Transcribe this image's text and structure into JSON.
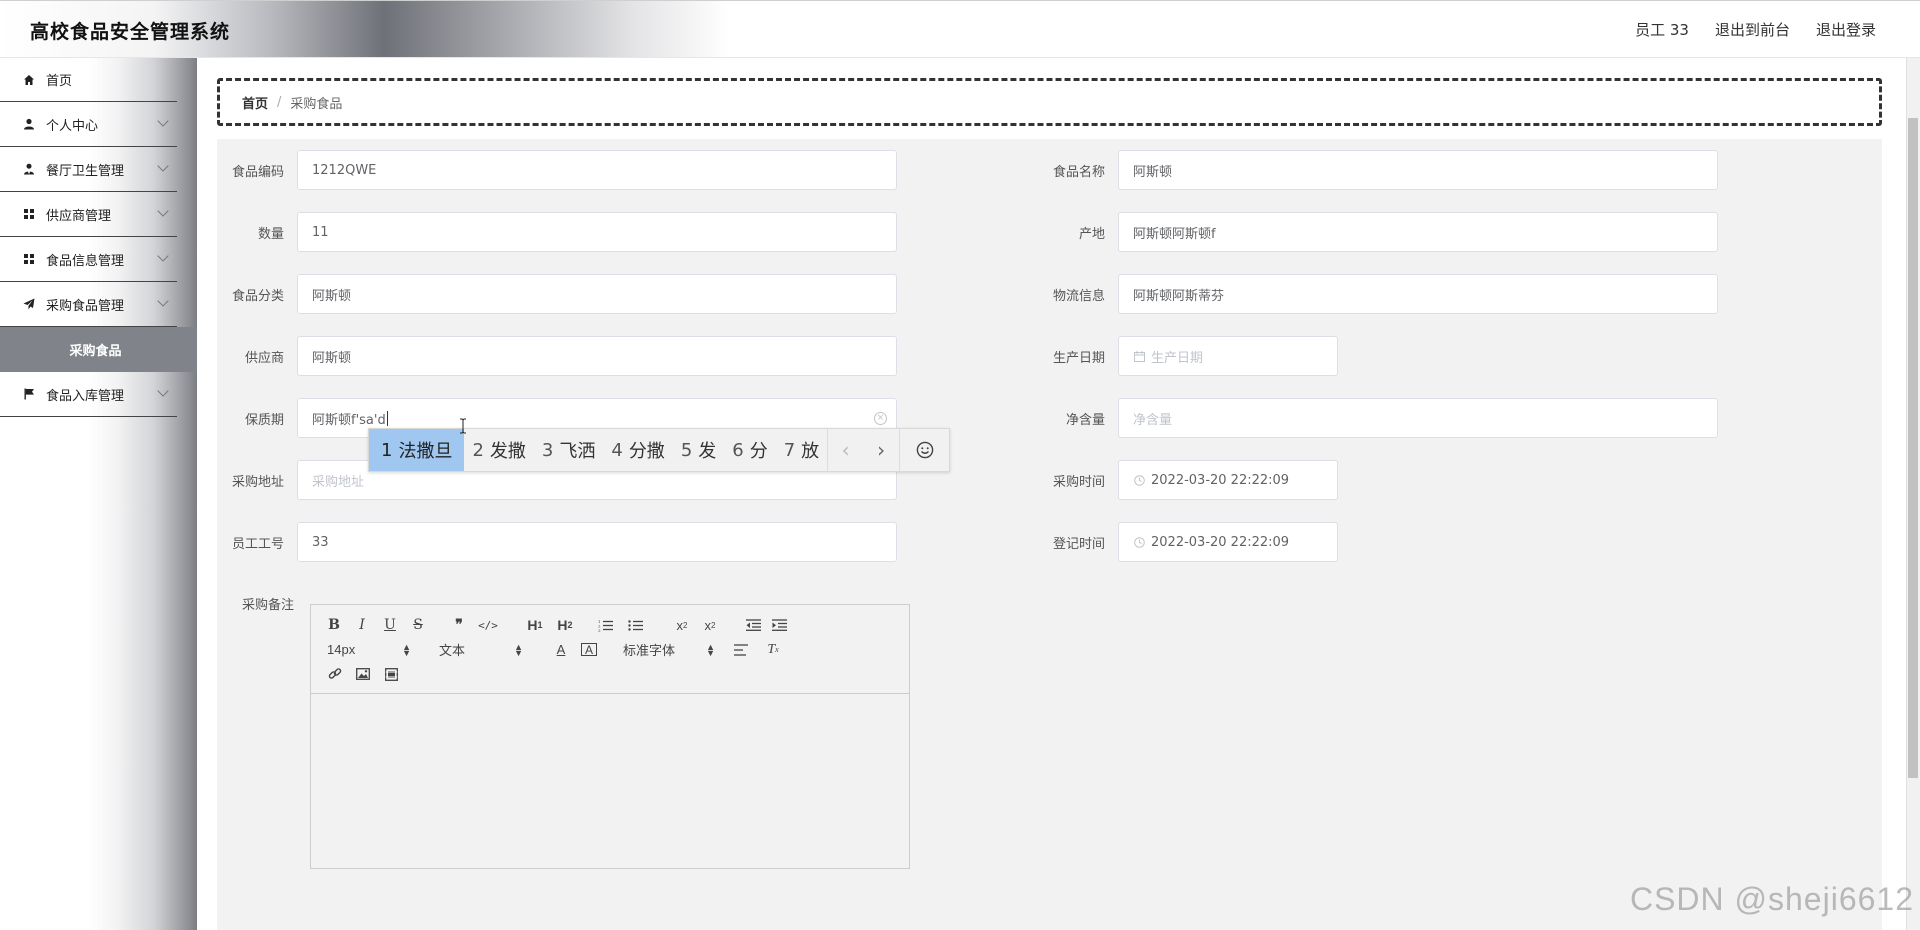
{
  "header": {
    "title": "高校食品安全管理系统",
    "user_label": "员工 33",
    "to_frontend": "退出到前台",
    "logout": "退出登录"
  },
  "sidebar": {
    "items": [
      {
        "label": "首页",
        "icon": "home-icon"
      },
      {
        "label": "个人中心",
        "icon": "user-icon"
      },
      {
        "label": "餐厅卫生管理",
        "icon": "user-tie-icon"
      },
      {
        "label": "供应商管理",
        "icon": "grid-icon"
      },
      {
        "label": "食品信息管理",
        "icon": "grid-icon"
      },
      {
        "label": "采购食品管理",
        "icon": "paper-plane-icon"
      },
      {
        "label": "采购食品",
        "icon": ""
      },
      {
        "label": "食品入库管理",
        "icon": "flag-icon"
      }
    ]
  },
  "breadcrumb": {
    "home": "首页",
    "separator": "/",
    "current": "采购食品"
  },
  "form": {
    "food_code": {
      "label": "食品编码",
      "value": "1212QWE"
    },
    "food_name": {
      "label": "食品名称",
      "value": "阿斯顿"
    },
    "quantity": {
      "label": "数量",
      "value": "11"
    },
    "origin": {
      "label": "产地",
      "value": "阿斯顿阿斯顿f"
    },
    "category": {
      "label": "食品分类",
      "value": "阿斯顿"
    },
    "logistics": {
      "label": "物流信息",
      "value": "阿斯顿阿斯蒂芬"
    },
    "supplier": {
      "label": "供应商",
      "value": "阿斯顿"
    },
    "production_date": {
      "label": "生产日期",
      "placeholder": "生产日期"
    },
    "shelf_life": {
      "label": "保质期",
      "value": "阿斯顿f'sa'd"
    },
    "net_content": {
      "label": "净含量",
      "placeholder": "净含量"
    },
    "purchase_address": {
      "label": "采购地址",
      "placeholder": "采购地址"
    },
    "purchase_time": {
      "label": "采购时间",
      "value": "2022-03-20 22:22:09"
    },
    "employee_id": {
      "label": "员工工号",
      "value": "33"
    },
    "register_time": {
      "label": "登记时间",
      "value": "2022-03-20 22:22:09"
    },
    "remarks": {
      "label": "采购备注"
    }
  },
  "editor": {
    "font_size": "14px",
    "block_type": "文本",
    "font_family": "标准字体"
  },
  "ime": {
    "candidates": [
      {
        "num": "1",
        "text": "法撒旦"
      },
      {
        "num": "2",
        "text": "发撒"
      },
      {
        "num": "3",
        "text": "飞洒"
      },
      {
        "num": "4",
        "text": "分撒"
      },
      {
        "num": "5",
        "text": "发"
      },
      {
        "num": "6",
        "text": "分"
      },
      {
        "num": "7",
        "text": "放"
      }
    ]
  },
  "watermark": "CSDN @sheji6612"
}
